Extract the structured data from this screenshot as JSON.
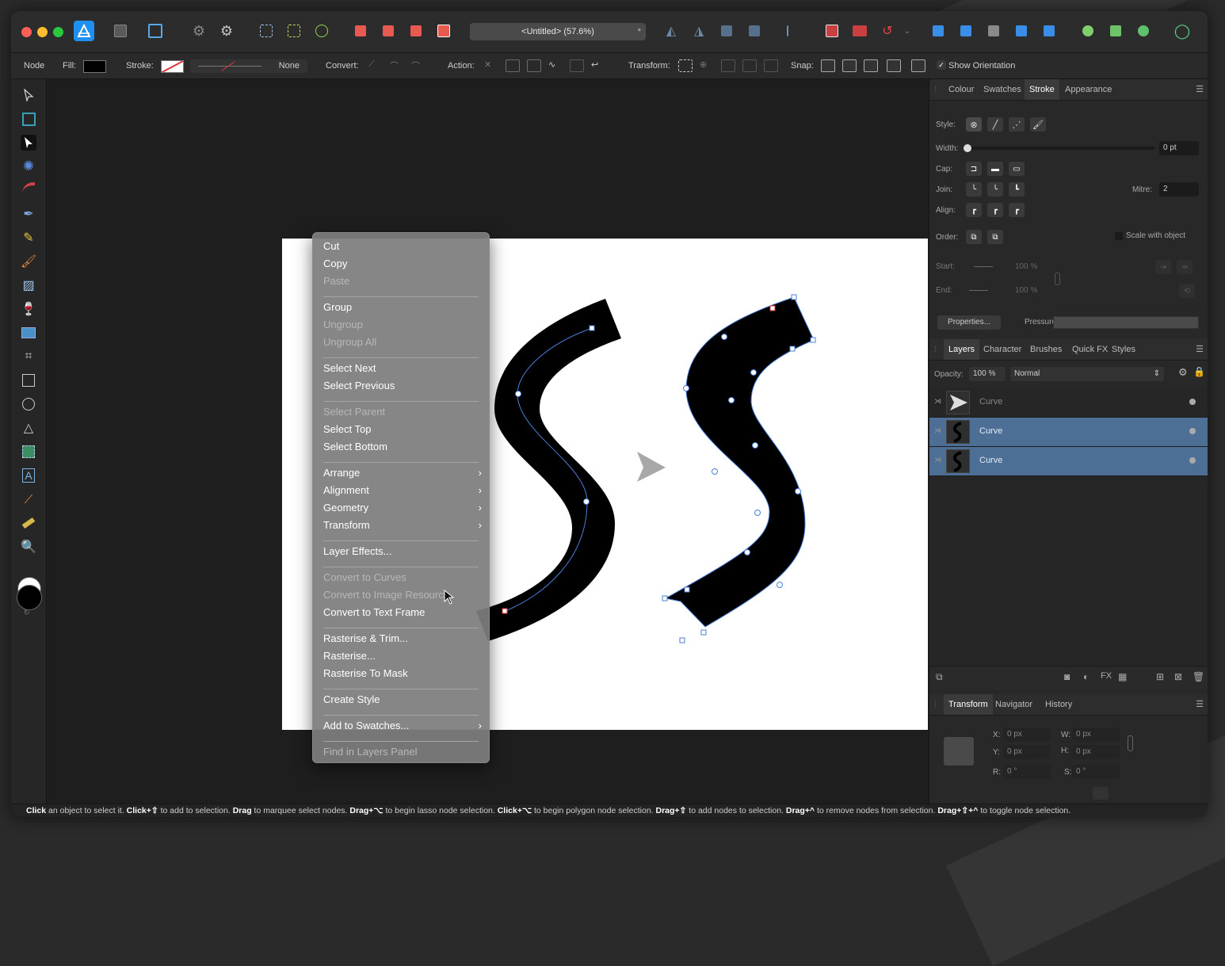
{
  "window": {
    "title": "<Untitled> (57.6%)"
  },
  "context_toolbar": {
    "mode": "Node",
    "fill_label": "Fill:",
    "stroke_label": "Stroke:",
    "stroke_value": "None",
    "convert_label": "Convert:",
    "action_label": "Action:",
    "transform_label": "Transform:",
    "snap_label": "Snap:",
    "show_orientation": "Show Orientation"
  },
  "stroke_panel": {
    "tabs": [
      "Colour",
      "Swatches",
      "Stroke",
      "Appearance"
    ],
    "active_tab": "Stroke",
    "style_label": "Style:",
    "width_label": "Width:",
    "width_value": "0 pt",
    "cap_label": "Cap:",
    "join_label": "Join:",
    "mitre_label": "Mitre:",
    "mitre_value": "2",
    "align_label": "Align:",
    "order_label": "Order:",
    "scale_with_object": "Scale with object",
    "start_label": "Start:",
    "start_pct": "100 %",
    "start_pct2": "100 %",
    "end_label": "End:",
    "end_pct": "100 %",
    "end_pct2": "100 %",
    "properties_button": "Properties...",
    "pressure_label": "Pressure:"
  },
  "layers_panel": {
    "tabs": [
      "Layers",
      "Character",
      "Brushes",
      "Quick FX",
      "Styles"
    ],
    "active_tab": "Layers",
    "opacity_label": "Opacity:",
    "opacity_value": "100 %",
    "blend_mode": "Normal",
    "layers": [
      {
        "name": "Curve",
        "selected": false,
        "thumb": "arrow"
      },
      {
        "name": "Curve",
        "selected": true,
        "thumb": "s-curve"
      },
      {
        "name": "Curve",
        "selected": true,
        "thumb": "s-curve"
      }
    ]
  },
  "transform_panel": {
    "tabs": [
      "Transform",
      "Navigator",
      "History"
    ],
    "active_tab": "Transform",
    "x_label": "X:",
    "x_value": "0 px",
    "y_label": "Y:",
    "y_value": "0 px",
    "w_label": "W:",
    "w_value": "0 px",
    "h_label": "H:",
    "h_value": "0 px",
    "r_label": "R:",
    "r_value": "0 °",
    "s_label": "S:",
    "s_value": "0 °"
  },
  "context_menu": {
    "items": [
      {
        "label": "Cut",
        "disabled": false,
        "submenu": false
      },
      {
        "label": "Copy",
        "disabled": false,
        "submenu": false
      },
      {
        "label": "Paste",
        "disabled": true,
        "submenu": false
      },
      {
        "separator": true
      },
      {
        "label": "Group",
        "disabled": false,
        "submenu": false
      },
      {
        "label": "Ungroup",
        "disabled": true,
        "submenu": false
      },
      {
        "label": "Ungroup All",
        "disabled": true,
        "submenu": false
      },
      {
        "separator": true
      },
      {
        "label": "Select Next",
        "disabled": false,
        "submenu": false
      },
      {
        "label": "Select Previous",
        "disabled": false,
        "submenu": false
      },
      {
        "separator": true
      },
      {
        "label": "Select Parent",
        "disabled": true,
        "submenu": false
      },
      {
        "label": "Select Top",
        "disabled": false,
        "submenu": false
      },
      {
        "label": "Select Bottom",
        "disabled": false,
        "submenu": false
      },
      {
        "separator": true
      },
      {
        "label": "Arrange",
        "disabled": false,
        "submenu": true
      },
      {
        "label": "Alignment",
        "disabled": false,
        "submenu": true
      },
      {
        "label": "Geometry",
        "disabled": false,
        "submenu": true
      },
      {
        "label": "Transform",
        "disabled": false,
        "submenu": true
      },
      {
        "separator": true
      },
      {
        "label": "Layer Effects...",
        "disabled": false,
        "submenu": false
      },
      {
        "separator": true
      },
      {
        "label": "Convert to Curves",
        "disabled": true,
        "submenu": false
      },
      {
        "label": "Convert to Image Resource",
        "disabled": true,
        "submenu": false
      },
      {
        "label": "Convert to Text Frame",
        "disabled": false,
        "submenu": false
      },
      {
        "separator": true
      },
      {
        "label": "Rasterise & Trim...",
        "disabled": false,
        "submenu": false
      },
      {
        "label": "Rasterise...",
        "disabled": false,
        "submenu": false
      },
      {
        "label": "Rasterise To Mask",
        "disabled": false,
        "submenu": false
      },
      {
        "separator": true
      },
      {
        "label": "Create Style",
        "disabled": false,
        "submenu": false
      },
      {
        "separator": true
      },
      {
        "label": "Add to Swatches...",
        "disabled": false,
        "submenu": true
      },
      {
        "separator": true
      },
      {
        "label": "Find in Layers Panel",
        "disabled": true,
        "submenu": false
      }
    ]
  },
  "status_bar": [
    {
      "b": "Click"
    },
    {
      "t": " an object to select it. "
    },
    {
      "b": "Click+⇧"
    },
    {
      "t": " to add to selection. "
    },
    {
      "b": "Drag"
    },
    {
      "t": " to marquee select nodes. "
    },
    {
      "b": "Drag+⌥"
    },
    {
      "t": " to begin lasso node selection. "
    },
    {
      "b": "Click+⌥"
    },
    {
      "t": " to begin polygon node selection. "
    },
    {
      "b": "Drag+⇧"
    },
    {
      "t": " to add nodes to selection. "
    },
    {
      "b": "Drag+^"
    },
    {
      "t": " to remove nodes from selection. "
    },
    {
      "b": "Drag+⇧+^"
    },
    {
      "t": " to toggle node selection."
    }
  ],
  "colors": {
    "accent": "#4a90e2",
    "selection": "#4d6e95",
    "app_bg": "#1f1f1f"
  }
}
